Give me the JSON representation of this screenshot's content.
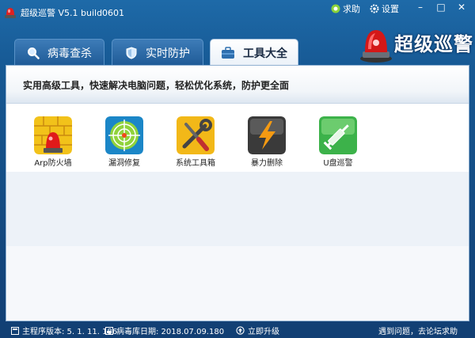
{
  "window": {
    "title": "超级巡警 V5.1 build0601"
  },
  "titlebar": {
    "help_label": "求助",
    "settings_label": "设置"
  },
  "brand": {
    "name": "超级巡警"
  },
  "tabs": [
    {
      "label": "病毒查杀",
      "active": false,
      "icon": "magnifier-icon"
    },
    {
      "label": "实时防护",
      "active": false,
      "icon": "shield-icon"
    },
    {
      "label": "工具大全",
      "active": true,
      "icon": "toolbox-icon"
    }
  ],
  "banner": {
    "text": "实用高级工具，快速解决电脑问题，轻松优化系统，防护更全面"
  },
  "tools": [
    {
      "label": "Arp防火墙",
      "icon": "firewall-icon",
      "color": "#f2c21a"
    },
    {
      "label": "漏洞修复",
      "icon": "target-icon",
      "color": "#1b86c7"
    },
    {
      "label": "系统工具箱",
      "icon": "wrench-screwdriver-icon",
      "color": "#f2b818"
    },
    {
      "label": "暴力删除",
      "icon": "lightning-icon",
      "color": "#3a3a3a"
    },
    {
      "label": "U盘巡警",
      "icon": "syringe-icon",
      "color": "#3cb24a"
    }
  ],
  "status": {
    "version": "主程序版本: 5. 1. 11. 186",
    "virus_db": "病毒库日期: 2018.07.09.180",
    "upgrade": "立即升级",
    "forum": "遇到问题，去论坛求助"
  }
}
